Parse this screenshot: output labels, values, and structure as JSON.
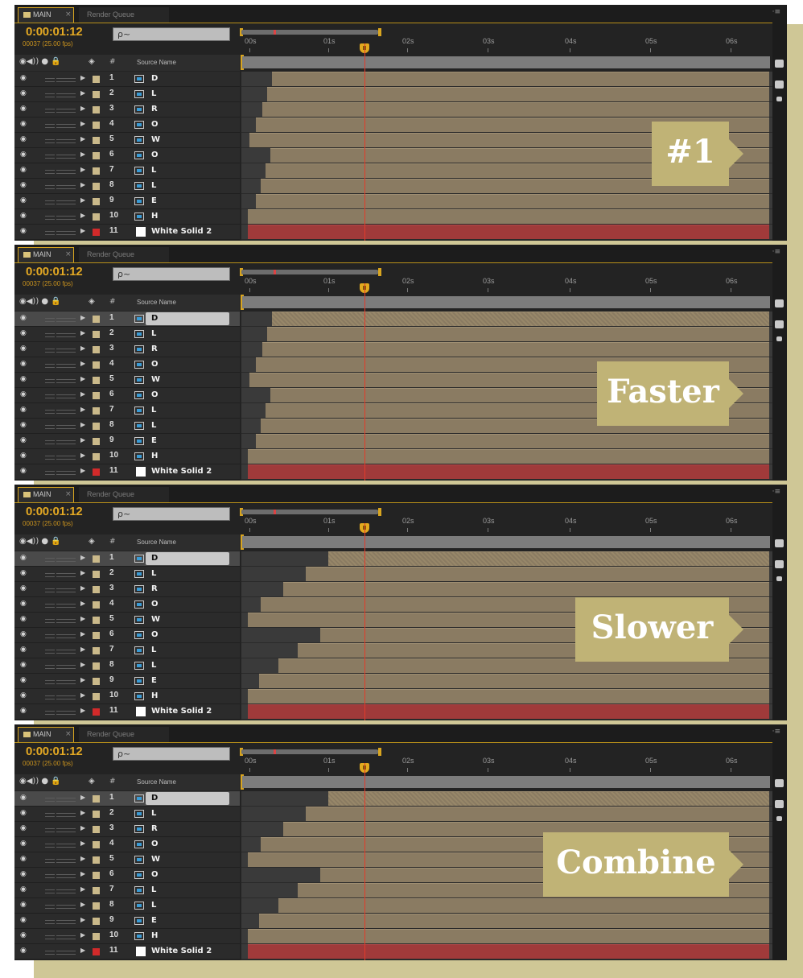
{
  "window": {
    "tab_main": "MAIN",
    "tab_close": "×",
    "tab_render_queue": "Render Queue",
    "panel_menu": "·≡"
  },
  "timeline": {
    "timecode": "0:00:01:12",
    "frames": "00037 (25.00 fps)",
    "search_icon": "ρ~",
    "column_hash": "#",
    "column_source_name": "Source Name",
    "ruler_ticks": [
      "00s",
      "01s",
      "02s",
      "03s",
      "04s",
      "05s",
      "06s"
    ]
  },
  "panels": [
    {
      "id": "p1",
      "caption": "#1",
      "selected_layer": 0,
      "layers": [
        {
          "num": "1",
          "name": "D"
        },
        {
          "num": "2",
          "name": "L"
        },
        {
          "num": "3",
          "name": "R"
        },
        {
          "num": "4",
          "name": "O"
        },
        {
          "num": "5",
          "name": "W"
        },
        {
          "num": "6",
          "name": "O"
        },
        {
          "num": "7",
          "name": "L"
        },
        {
          "num": "8",
          "name": "L"
        },
        {
          "num": "9",
          "name": "E"
        },
        {
          "num": "10",
          "name": "H"
        },
        {
          "num": "11",
          "name": "White Solid 2"
        }
      ]
    },
    {
      "id": "p2",
      "caption": "Faster",
      "selected_layer": 1,
      "layers": [
        {
          "num": "1",
          "name": "D"
        },
        {
          "num": "2",
          "name": "L"
        },
        {
          "num": "3",
          "name": "R"
        },
        {
          "num": "4",
          "name": "O"
        },
        {
          "num": "5",
          "name": "W"
        },
        {
          "num": "6",
          "name": "O"
        },
        {
          "num": "7",
          "name": "L"
        },
        {
          "num": "8",
          "name": "L"
        },
        {
          "num": "9",
          "name": "E"
        },
        {
          "num": "10",
          "name": "H"
        },
        {
          "num": "11",
          "name": "White Solid 2"
        }
      ]
    },
    {
      "id": "p3",
      "caption": "Slower",
      "selected_layer": 1,
      "layers": [
        {
          "num": "1",
          "name": "D"
        },
        {
          "num": "2",
          "name": "L"
        },
        {
          "num": "3",
          "name": "R"
        },
        {
          "num": "4",
          "name": "O"
        },
        {
          "num": "5",
          "name": "W"
        },
        {
          "num": "6",
          "name": "O"
        },
        {
          "num": "7",
          "name": "L"
        },
        {
          "num": "8",
          "name": "L"
        },
        {
          "num": "9",
          "name": "E"
        },
        {
          "num": "10",
          "name": "H"
        },
        {
          "num": "11",
          "name": "White Solid 2"
        }
      ]
    },
    {
      "id": "p4",
      "caption": "Combine",
      "selected_layer": 1,
      "layers": [
        {
          "num": "1",
          "name": "D"
        },
        {
          "num": "2",
          "name": "L"
        },
        {
          "num": "3",
          "name": "R"
        },
        {
          "num": "4",
          "name": "O"
        },
        {
          "num": "5",
          "name": "W"
        },
        {
          "num": "6",
          "name": "O"
        },
        {
          "num": "7",
          "name": "L"
        },
        {
          "num": "8",
          "name": "L"
        },
        {
          "num": "9",
          "name": "E"
        },
        {
          "num": "10",
          "name": "H"
        },
        {
          "num": "11",
          "name": "White Solid 2"
        }
      ]
    }
  ],
  "colors": {
    "accent": "#e3a823",
    "layer_bar": "#8a7b62",
    "solid_bar": "#a03a3a",
    "caption_tag": "#c0b376",
    "playhead": "#e33a2a"
  }
}
